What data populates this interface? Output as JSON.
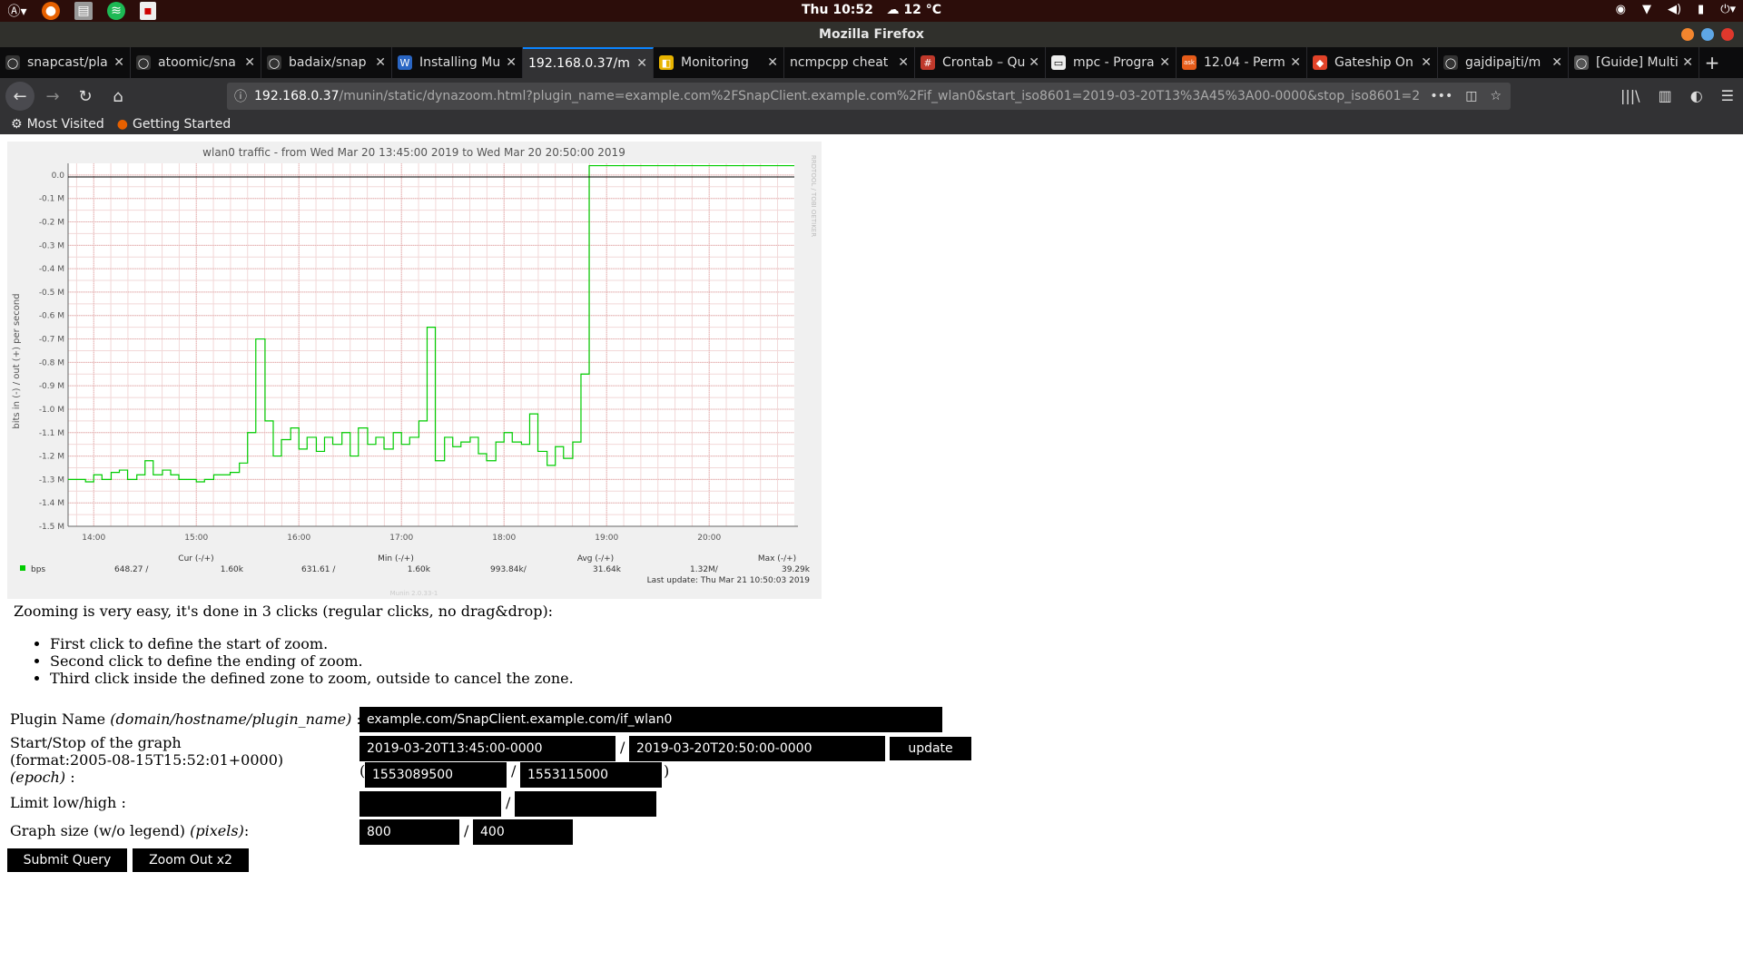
{
  "system": {
    "clock": "Thu 10:52",
    "weather": "12 °C"
  },
  "window": {
    "title": "Mozilla Firefox"
  },
  "tabs": [
    {
      "label": "snapcast/pla",
      "active": false
    },
    {
      "label": "atoomic/sna",
      "active": false
    },
    {
      "label": "badaix/snap",
      "active": false
    },
    {
      "label": "Installing Mu",
      "active": false
    },
    {
      "label": "192.168.0.37/m",
      "active": true
    },
    {
      "label": "Monitoring",
      "active": false
    },
    {
      "label": "ncmpcpp cheat",
      "active": false
    },
    {
      "label": "Crontab – Qu",
      "active": false
    },
    {
      "label": "mpc - Progra",
      "active": false
    },
    {
      "label": "12.04 - Perm",
      "active": false
    },
    {
      "label": "Gateship On",
      "active": false
    },
    {
      "label": "gajdipajti/m",
      "active": false
    },
    {
      "label": "[Guide] Multi",
      "active": false
    }
  ],
  "url": {
    "host": "192.168.0.37",
    "rest": "/munin/static/dynazoom.html?plugin_name=example.com%2FSnapClient.example.com%2Fif_wlan0&start_iso8601=2019-03-20T13%3A45%3A00-0000&stop_iso8601=2019-03-2"
  },
  "bookmarks": [
    "Most Visited",
    "Getting Started"
  ],
  "graph": {
    "title": "wlan0 traffic - from Wed Mar 20 13:45:00 2019 to Wed Mar 20 20:50:00 2019",
    "ylabel": "bits in (-) / out (+) per second",
    "watermark": "RRDTOOL / TOBI OETIKER",
    "legend_headers": {
      "cur": "Cur (-/+)",
      "min": "Min (-/+)",
      "avg": "Avg (-/+)",
      "max": "Max (-/+)"
    },
    "legend_row": {
      "name": "bps",
      "cur_in": "648.27 /",
      "cur_out": "1.60k",
      "min_in": "631.61 /",
      "min_out": "1.60k",
      "avg_in": "993.84k/",
      "avg_out": "31.64k",
      "max_in": "1.32M/",
      "max_out": "39.29k"
    },
    "last_update": "Last update:  Thu Mar 21 10:50:03 2019",
    "version": "Munin 2.0.33-1"
  },
  "chart_data": {
    "type": "line",
    "title": "wlan0 traffic - from Wed Mar 20 13:45:00 2019 to Wed Mar 20 20:50:00 2019",
    "xlabel": "",
    "ylabel": "bits in (-) / out (+) per second",
    "xlim": [
      13.75,
      20.83
    ],
    "ylim": [
      -1.5,
      0.05
    ],
    "x_ticks": [
      "14:00",
      "15:00",
      "16:00",
      "17:00",
      "18:00",
      "19:00",
      "20:00"
    ],
    "x_tick_values": [
      14,
      15,
      16,
      17,
      18,
      19,
      20
    ],
    "y_ticks": [
      "0.0",
      "-0.1 M",
      "-0.2 M",
      "-0.3 M",
      "-0.4 M",
      "-0.5 M",
      "-0.6 M",
      "-0.7 M",
      "-0.8 M",
      "-0.9 M",
      "-1.0 M",
      "-1.1 M",
      "-1.2 M",
      "-1.3 M",
      "-1.4 M",
      "-1.5 M"
    ],
    "y_tick_values": [
      0,
      -0.1,
      -0.2,
      -0.3,
      -0.4,
      -0.5,
      -0.6,
      -0.7,
      -0.8,
      -0.9,
      -1.0,
      -1.1,
      -1.2,
      -1.3,
      -1.4,
      -1.5
    ],
    "grid": true,
    "series": [
      {
        "name": "bps",
        "color": "#00cc00",
        "step": true,
        "x": [
          13.75,
          13.92,
          14.0,
          14.08,
          14.17,
          14.25,
          14.33,
          14.42,
          14.5,
          14.58,
          14.67,
          14.75,
          14.83,
          14.92,
          15.0,
          15.08,
          15.17,
          15.25,
          15.33,
          15.42,
          15.5,
          15.58,
          15.67,
          15.75,
          15.83,
          15.92,
          16.0,
          16.08,
          16.17,
          16.25,
          16.33,
          16.42,
          16.5,
          16.58,
          16.67,
          16.75,
          16.83,
          16.92,
          17.0,
          17.08,
          17.17,
          17.25,
          17.33,
          17.42,
          17.5,
          17.58,
          17.67,
          17.75,
          17.83,
          17.92,
          18.0,
          18.08,
          18.17,
          18.25,
          18.33,
          18.42,
          18.5,
          18.58,
          18.67,
          18.75,
          18.83,
          18.92,
          19.0,
          19.08,
          19.17,
          19.25,
          19.33,
          19.42,
          19.5,
          19.58,
          19.67,
          19.75,
          19.83,
          19.92,
          20.0,
          20.08,
          20.17,
          20.25,
          20.33,
          20.42,
          20.5,
          20.58,
          20.67,
          20.75,
          20.83
        ],
        "y": [
          -1.3,
          -1.31,
          -1.28,
          -1.3,
          -1.27,
          -1.26,
          -1.3,
          -1.28,
          -1.22,
          -1.28,
          -1.26,
          -1.28,
          -1.3,
          -1.3,
          -1.31,
          -1.3,
          -1.28,
          -1.28,
          -1.27,
          -1.23,
          -1.1,
          -0.7,
          -1.05,
          -1.2,
          -1.13,
          -1.08,
          -1.17,
          -1.12,
          -1.18,
          -1.12,
          -1.15,
          -1.1,
          -1.2,
          -1.08,
          -1.15,
          -1.12,
          -1.17,
          -1.1,
          -1.15,
          -1.12,
          -1.05,
          -0.65,
          -1.22,
          -1.12,
          -1.16,
          -1.14,
          -1.12,
          -1.19,
          -1.22,
          -1.14,
          -1.1,
          -1.14,
          -1.15,
          -1.02,
          -1.18,
          -1.24,
          -1.16,
          -1.21,
          -1.14,
          -0.85,
          0.04,
          0.04,
          0.04,
          0.04,
          0.04,
          0.04,
          0.04,
          0.04,
          0.04,
          0.04,
          0.04,
          0.04,
          0.04,
          0.04,
          0.04,
          0.04,
          0.04,
          0.04,
          0.04,
          0.04,
          0.04,
          0.04,
          0.04,
          0.04,
          0.04
        ]
      }
    ]
  },
  "intro": "Zooming is very easy, it's done in 3 clicks (regular clicks, no drag&drop):",
  "bullets": [
    "First click to define the start of zoom.",
    "Second click to define the ending of zoom.",
    "Third click inside the defined zone to zoom, outside to cancel the zone."
  ],
  "form": {
    "plugin_label": "Plugin Name",
    "plugin_hint": "(domain/hostname/plugin_name)",
    "plugin_value": "example.com/SnapClient.example.com/if_wlan0",
    "startstop_label": "Start/Stop of the graph",
    "format_label": "(format:2005-08-15T15:52:01+0000)",
    "epoch_label": "(epoch)",
    "start_iso": "2019-03-20T13:45:00-0000",
    "stop_iso": "2019-03-20T20:50:00-0000",
    "update_label": "update",
    "start_epoch": "1553089500",
    "stop_epoch": "1553115000",
    "limit_label": "Limit low/high :",
    "limit_low": "",
    "limit_high": "",
    "size_label": "Graph size (w/o legend)",
    "size_hint": "(pixels)",
    "width": "800",
    "height": "400",
    "submit_label": "Submit Query",
    "zoomout_label": "Zoom Out x2",
    "colon": ":",
    "slash": "/",
    "lparen": "(",
    "rparen": ")"
  }
}
